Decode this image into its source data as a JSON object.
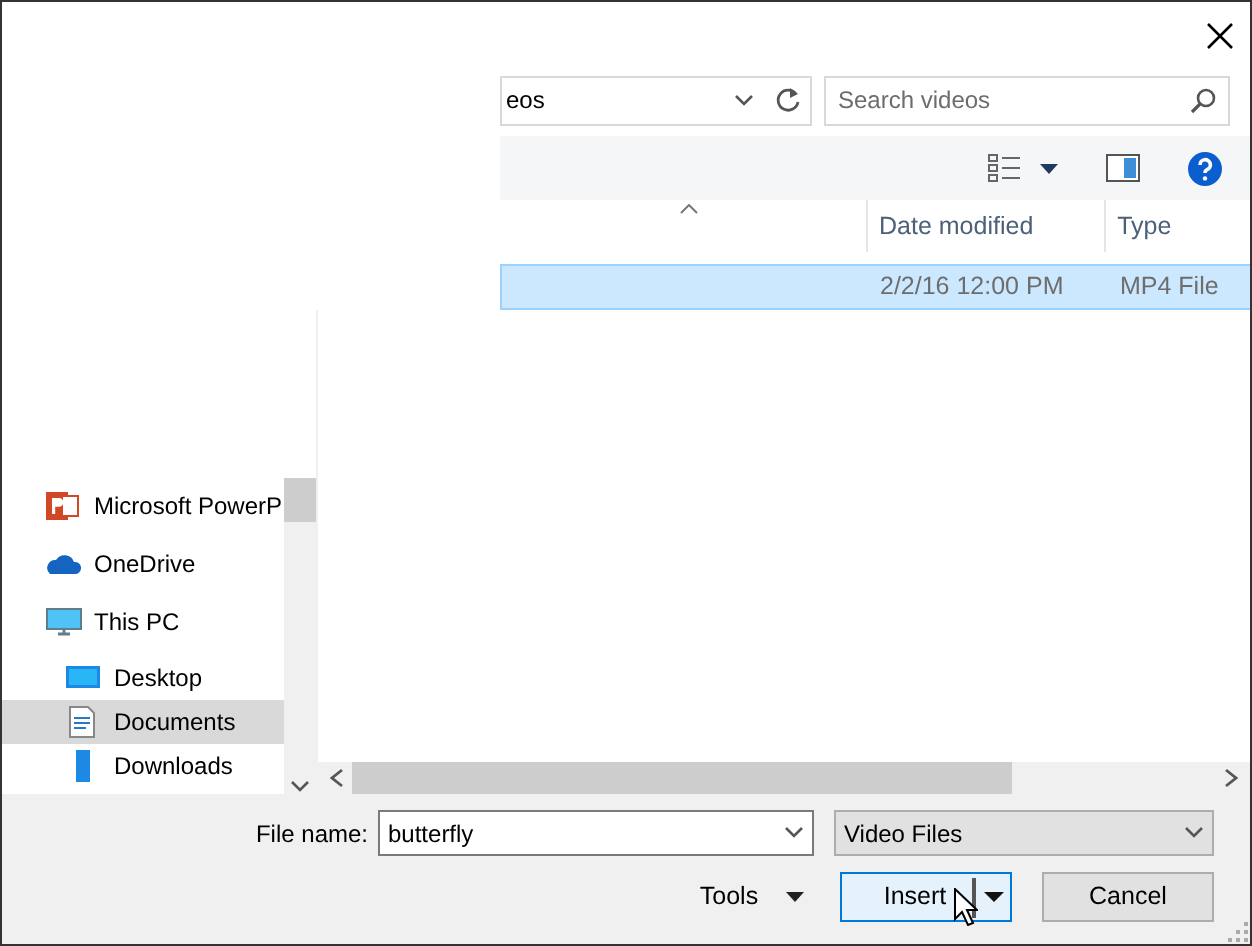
{
  "address": {
    "text": "eos"
  },
  "search": {
    "placeholder": "Search videos"
  },
  "name_column": {
    "sorted": true
  },
  "columns": [
    {
      "label": "Date modified"
    },
    {
      "label": "Type"
    }
  ],
  "rows": [
    {
      "date": "2/2/16 12:00 PM",
      "type": "MP4 File",
      "selected": true
    }
  ],
  "nav": [
    {
      "label": "Microsoft PowerP",
      "kind": "powerpoint",
      "selected": false
    },
    {
      "label": "OneDrive",
      "kind": "cloud",
      "selected": false
    },
    {
      "label": "This PC",
      "kind": "pc",
      "selected": false,
      "children": [
        {
          "label": "Desktop",
          "kind": "desktop",
          "selected": false
        },
        {
          "label": "Documents",
          "kind": "documents",
          "selected": true
        },
        {
          "label": "Downloads",
          "kind": "downloads",
          "selected": false
        }
      ]
    }
  ],
  "file_name": {
    "label": "File name:",
    "value": "butterfly"
  },
  "file_type": {
    "value": "Video Files"
  },
  "buttons": [
    {
      "kind": "menu",
      "label": "Tools"
    },
    {
      "kind": "split",
      "label": "Insert",
      "default": true
    },
    {
      "kind": "plain",
      "label": "Cancel"
    }
  ]
}
